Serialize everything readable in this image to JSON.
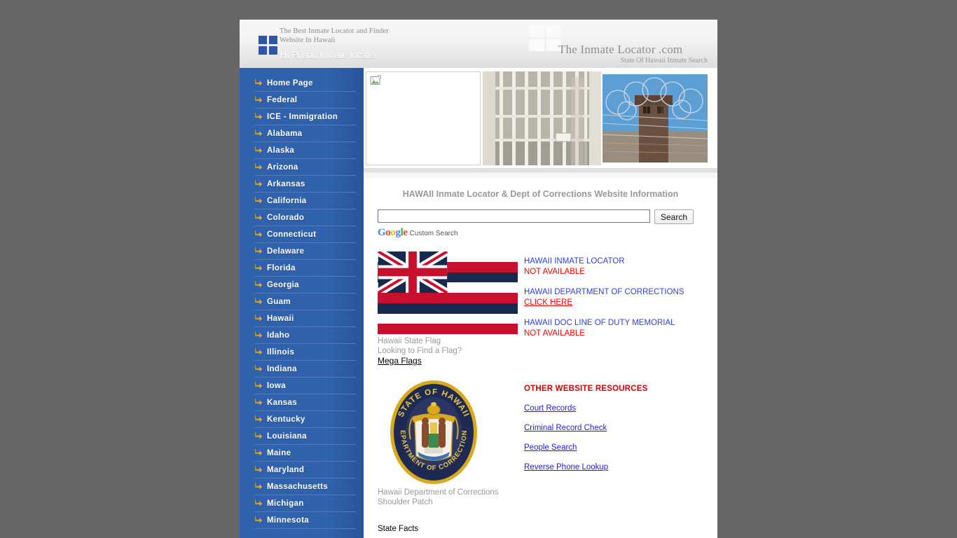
{
  "header": {
    "tagline_line1": "The Best Inmate Locator and Finder",
    "tagline_line2": "Website In Hawaii",
    "site_title": "HI Prison Inmate locater",
    "brand": "The Inmate Locator .com",
    "brand_sub": "State Of Hawaii Inmate Search",
    "logo_icon": "four-square-grid-icon"
  },
  "sidebar": {
    "items": [
      {
        "label": "Home Page"
      },
      {
        "label": "Federal"
      },
      {
        "label": "ICE - Immigration"
      },
      {
        "label": "Alabama"
      },
      {
        "label": "Alaska"
      },
      {
        "label": "Arizona"
      },
      {
        "label": "Arkansas"
      },
      {
        "label": "California"
      },
      {
        "label": "Colorado"
      },
      {
        "label": "Connecticut"
      },
      {
        "label": "Delaware"
      },
      {
        "label": "Florida"
      },
      {
        "label": "Georgia"
      },
      {
        "label": "Guam"
      },
      {
        "label": "Hawaii"
      },
      {
        "label": "Idaho"
      },
      {
        "label": "Illinois"
      },
      {
        "label": "Indiana"
      },
      {
        "label": "Iowa"
      },
      {
        "label": "Kansas"
      },
      {
        "label": "Kentucky"
      },
      {
        "label": "Louisiana"
      },
      {
        "label": "Maine"
      },
      {
        "label": "Maryland"
      },
      {
        "label": "Massachusetts"
      },
      {
        "label": "Michigan"
      },
      {
        "label": "Minnesota"
      }
    ]
  },
  "banner": {
    "image1_alt": "broken-image-placeholder",
    "image2_alt": "prison-cell-bars-photo",
    "image3_alt": "guard-tower-razor-wire-photo"
  },
  "main": {
    "heading": "HAWAII Inmate Locator & Dept of Corrections Website Information",
    "search": {
      "value": "",
      "placeholder": "",
      "button_label": "Search",
      "branding_logo": "Google",
      "branding_label": "Custom Search"
    },
    "flag": {
      "caption_line1": "Hawaii State Flag",
      "caption_line2": "Looking to Find a Flag?",
      "link_label": "Mega Flags"
    },
    "links": [
      {
        "title": "HAWAII INMATE LOCATOR",
        "status": "NOT AVAILABLE",
        "is_link": false
      },
      {
        "title": "HAWAII DEPARTMENT OF CORRECTIONS",
        "status": "CLICK HERE",
        "is_link": true
      },
      {
        "title": "HAWAII DOC LINE OF DUTY MEMORIAL",
        "status": "NOT AVAILABLE",
        "is_link": false
      }
    ],
    "patch": {
      "caption_line1": "Hawaii Department of Corrections",
      "caption_line2": "Shoulder Patch",
      "text_top": "STATE OF HAWAII",
      "text_bottom": "DEPARTMENT OF CORRECTIONS"
    },
    "resources": {
      "title": "OTHER WEBSITE RESOURCES",
      "links": [
        {
          "label": "Court Records"
        },
        {
          "label": "Criminal Record Check"
        },
        {
          "label": "People Search"
        },
        {
          "label": "Reverse Phone Lookup"
        }
      ]
    },
    "state_facts_label": "State Facts"
  },
  "colors": {
    "sidebar_blue": "#2f62ab",
    "arrow_gold": "#f0a81e",
    "link_blue": "#2222cc",
    "status_red": "#ee0000",
    "resources_red": "#d40000",
    "page_bg": "#666666"
  }
}
